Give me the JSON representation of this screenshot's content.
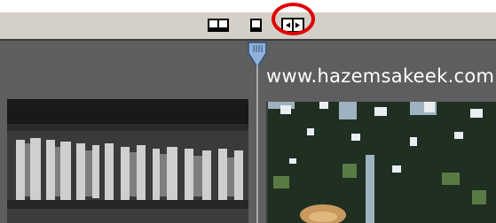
{
  "watermark": {
    "text": "www.hazemsakeek.com"
  },
  "toolbar": {
    "buttons": [
      {
        "icon": "two-page-view-icon"
      },
      {
        "icon": "single-page-view-icon"
      },
      {
        "icon": "split-view-icon",
        "highlighted": true
      }
    ],
    "highlight_color": "#e00000"
  },
  "colors": {
    "toolbar_bg": "#d4d0c8",
    "workspace_bg": "#5e5e5e",
    "handle_blue": "#8fb0d8"
  }
}
